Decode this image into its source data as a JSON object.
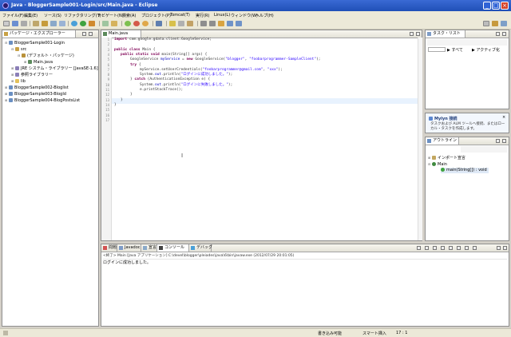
{
  "window": {
    "title": "Java - BloggerSample001-Login/src/Main.java - Eclipse"
  },
  "menus": [
    "ファイル(F)",
    "編集(E)",
    "ソース(S)",
    "リファクタリング(T)",
    "ナビゲート(N)",
    "検索(A)",
    "プロジェクト(P)",
    "Tomcat(T)",
    "実行(R)",
    "Linux(L)",
    "ウィンドウ(W)",
    "ヘルプ(H)"
  ],
  "package_explorer": {
    "tab_label": "パッケージ・エクスプローラー",
    "tree": [
      {
        "label": "BloggerSample001-Login",
        "expanded": true
      },
      {
        "label": "src",
        "expanded": true
      },
      {
        "label": "(デフォルト・パッケージ)",
        "expanded": true
      },
      {
        "label": "Main.java",
        "expanded": false
      },
      {
        "label": "JRE システム・ライブラリー [JavaSE-1.6]",
        "expanded": false
      },
      {
        "label": "参照ライブラリー",
        "expanded": false
      },
      {
        "label": "lib",
        "expanded": false
      },
      {
        "label": "BloggerSample002-Bloglist",
        "expanded": false
      },
      {
        "label": "BloggerSample003-BlogId",
        "expanded": false
      },
      {
        "label": "BloggerSample004-BlogPostsList",
        "expanded": false
      }
    ]
  },
  "editor": {
    "tab_label": "Main.java",
    "line_numbers": [
      "1",
      "2",
      "3",
      "4",
      "5",
      "6",
      "7",
      "8",
      "9",
      "10",
      "11",
      "12",
      "13",
      "14",
      "15",
      "16",
      "17"
    ],
    "import_keyword": "import",
    "import_rest": " com.google.gdata.client.GoogleService;",
    "class_decl_kw": "public class",
    "class_decl_rest": " Main {",
    "main_kw": "public static void",
    "main_rest": " main(String[] args) {",
    "service_line_a": "GoogleService ",
    "service_line_field": "myService",
    "service_line_b": " = ",
    "service_line_new": "new",
    "service_line_c": " GoogleService(",
    "service_line_str1": "\"blogger\"",
    "service_line_d": ", ",
    "service_line_str2": "\"foobarprogrammer-SampleClient\"",
    "service_line_e": ");",
    "try_kw": "try",
    "try_rest": " {",
    "setcred_a": "myService.setUserCredentials(",
    "setcred_str1": "\"foobarprogrammer@gmail.com\"",
    "setcred_b": ", ",
    "setcred_str2": "\"xxx\"",
    "setcred_c": ");",
    "println1_a": "System.",
    "println1_fld": "out",
    "println1_b": ".println(",
    "println1_str": "\"ログインに成功しました。\"",
    "println1_c": ");",
    "catch_a": "} ",
    "catch_kw": "catch",
    "catch_rest": " (AuthenticationException e) {",
    "println2_a": "System.",
    "println2_fld": "out",
    "println2_b": ".println(",
    "println2_str": "\"ログインに失敗しました。\"",
    "println2_c": ");",
    "stack_line": "e.printStackTrace();",
    "close_inner": "}",
    "close_method": "}",
    "close_class": "}"
  },
  "tasklist": {
    "tab_label": "タスク・リスト",
    "filter_all": "すべて",
    "filter_active": "アクティブ化"
  },
  "mylyn": {
    "title": "Mylyn 接続",
    "body": "タスクおよび ALM ツールへ接続、またはローカル・タスクを作成します。"
  },
  "outline": {
    "tab_label": "アウトライン",
    "items": [
      {
        "label": "インポート宣言"
      },
      {
        "label": "Main"
      },
      {
        "label": "main(String[]) : void"
      }
    ]
  },
  "console": {
    "tabs": [
      "問題",
      "Javadoc",
      "宣言",
      "コンソール",
      "デバッグ"
    ],
    "header": "<終了> Main [Java アプリケーション] C:\\devel\\blogger\\pleiades\\java\\6\\bin\\javaw.exe (2012/07/29 20:01:05)",
    "output": "ログインに成功しました。"
  },
  "statusbar": {
    "writable": "書き込み可能",
    "insert_mode": "スマート挿入",
    "position": "17 : 1"
  },
  "colors": {
    "title_bar": "#1f4fb7",
    "editor_current_line": "#e8f2fe",
    "keyword": "#7f0055",
    "string": "#2a00ff"
  }
}
